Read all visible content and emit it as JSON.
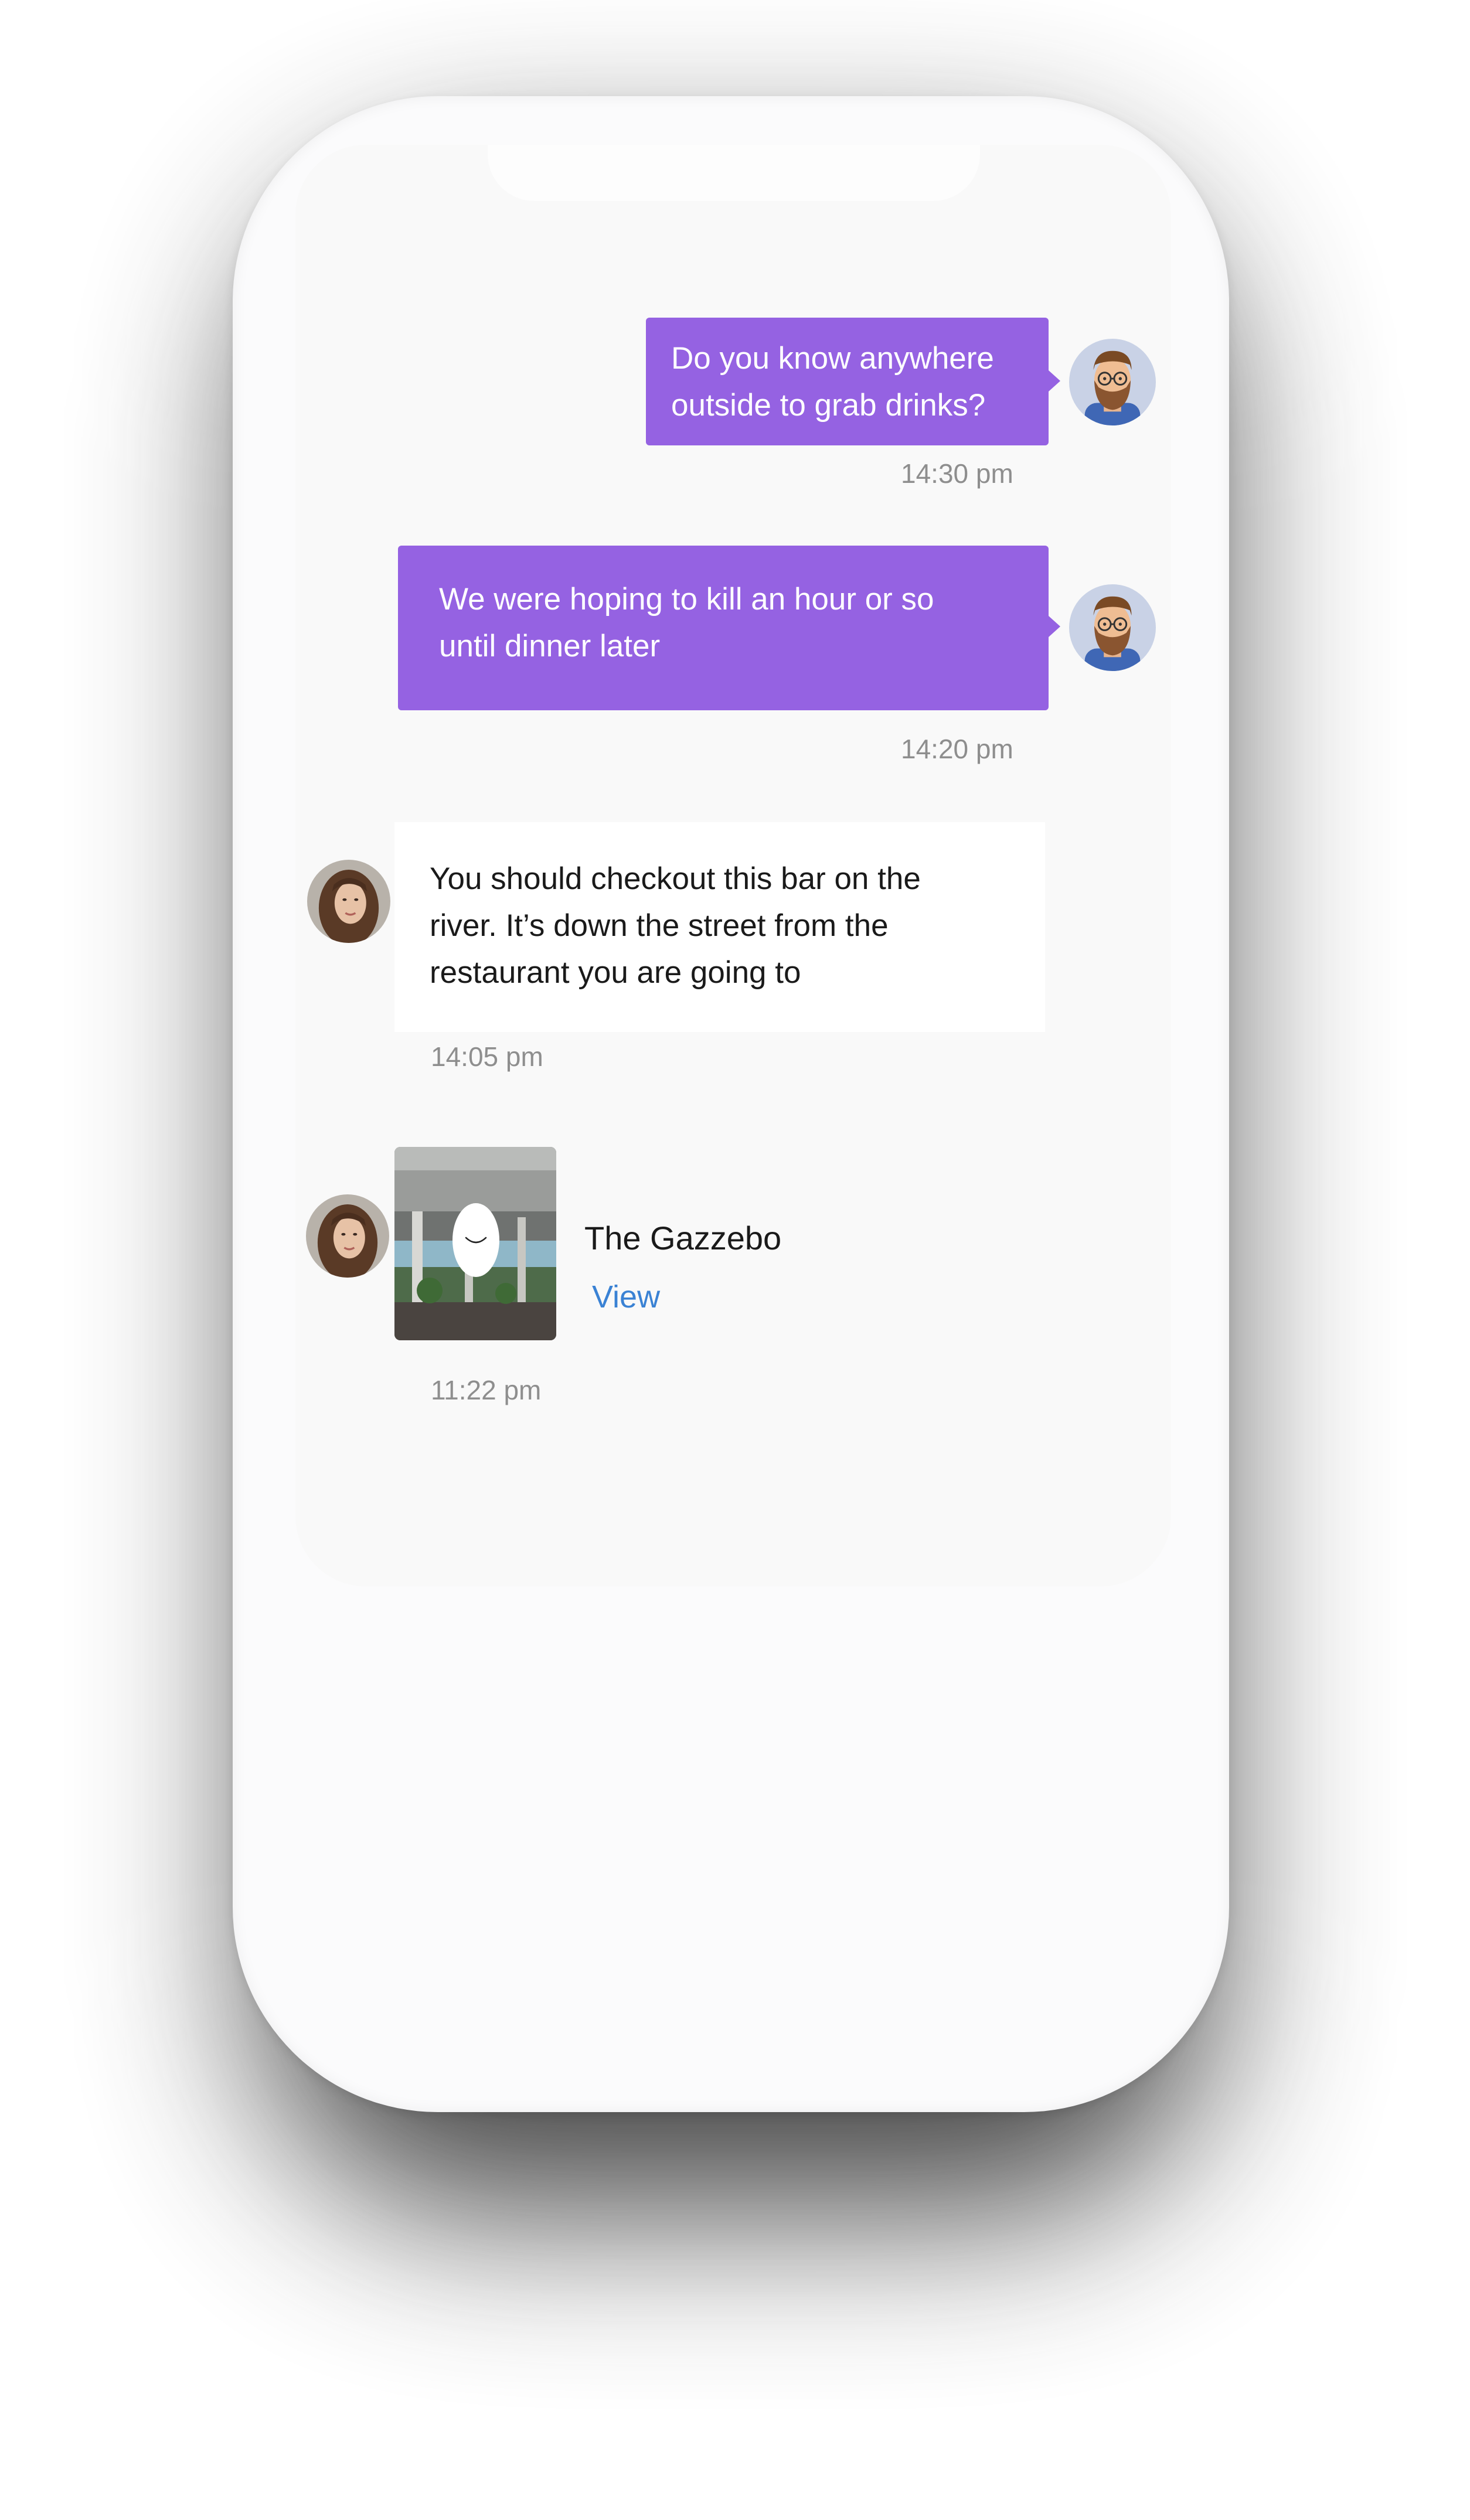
{
  "messages": [
    {
      "direction": "outgoing",
      "lines": [
        "Do you know anywhere",
        "outside to grab drinks?"
      ],
      "time": "14:30 pm"
    },
    {
      "direction": "outgoing",
      "lines": [
        "We were hoping to kill an hour or so",
        "until dinner later"
      ],
      "time": "14:20 pm"
    },
    {
      "direction": "incoming",
      "lines": [
        "You should checkout this bar on the",
        "river. It’s down the street from the",
        "restaurant you are going to"
      ],
      "time": "14:05 pm"
    }
  ],
  "place_card": {
    "title": "The Gazzebo",
    "link_label": "View",
    "time": "11:22 pm"
  },
  "colors": {
    "outgoing_bubble": "#9562e2",
    "incoming_bubble": "#ffffff",
    "timestamp": "#8e8e8e",
    "link": "#3a82d4"
  },
  "icons": {
    "sender_avatar": "bearded-man-avatar-icon",
    "recipient_avatar": "woman-photo-avatar",
    "media_badge": "chevron-down-icon"
  }
}
